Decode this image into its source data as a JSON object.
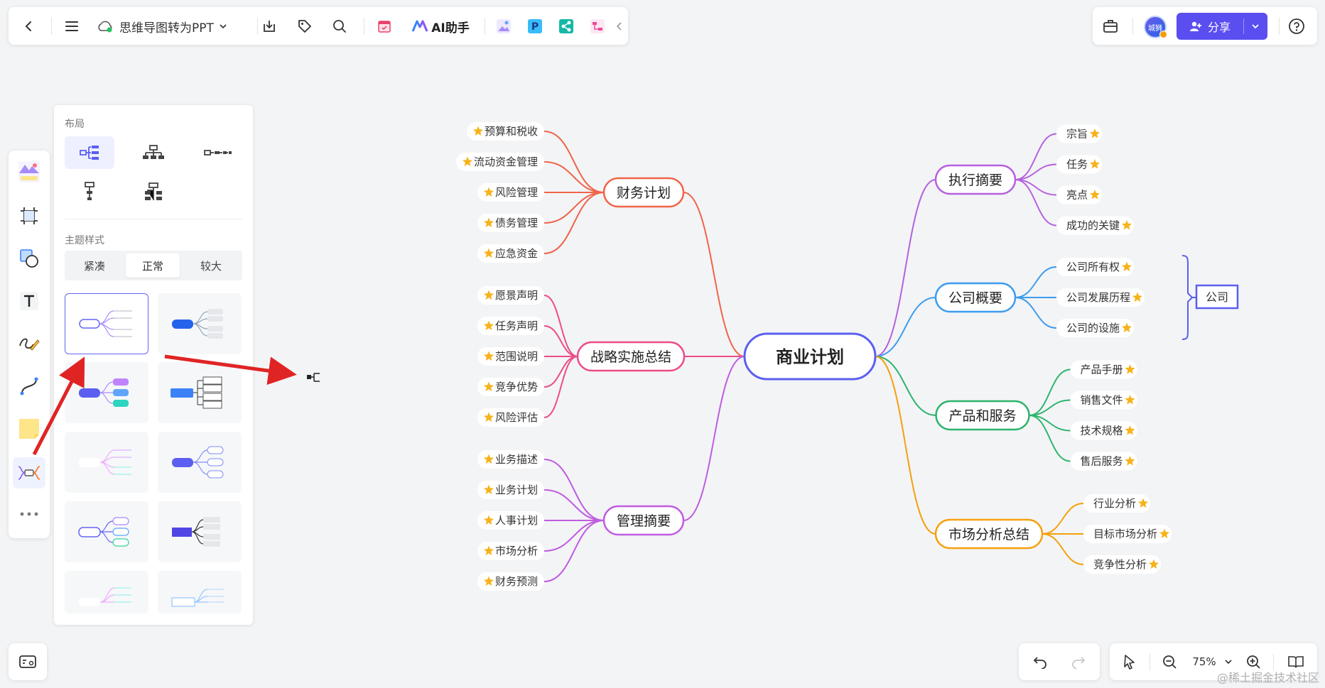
{
  "toolbar": {
    "doc_title": "思维导图转为PPT",
    "ai_label": "AI助手",
    "icons": [
      "back-icon",
      "menu-icon",
      "cloud-icon",
      "chevron-down-icon",
      "download-icon",
      "tag-icon",
      "search-icon",
      "calendar-icon",
      "ai-logo-icon",
      "image-plugin-icon",
      "p-plugin-icon",
      "share-plugin-icon",
      "diagram-plugin-icon",
      "collapse-left-icon"
    ]
  },
  "topright": {
    "avatar_text": "城狮",
    "share_label": "分享"
  },
  "left_toolbar": {
    "icons": [
      "template-icon",
      "frame-icon",
      "shape-icon",
      "text-icon",
      "pen-icon",
      "connector-icon",
      "sticky-note-icon",
      "mindmap-icon",
      "more-icon"
    ]
  },
  "layout_panel": {
    "layout_title": "布局",
    "theme_title": "主题样式",
    "density_options": [
      "紧凑",
      "正常",
      "较大"
    ],
    "density_selected": "正常"
  },
  "mindmap": {
    "root": "商业计划",
    "left_branches": [
      {
        "label": "财务计划",
        "color": "#f06449",
        "children": [
          "预算和税收",
          "流动资金管理",
          "风险管理",
          "债务管理",
          "应急资金"
        ]
      },
      {
        "label": "战略实施总结",
        "color": "#ec4c88",
        "children": [
          "愿景声明",
          "任务声明",
          "范围说明",
          "竞争优势",
          "风险评估"
        ]
      },
      {
        "label": "管理摘要",
        "color": "#c05ce0",
        "children": [
          "业务描述",
          "业务计划",
          "人事计划",
          "市场分析",
          "财务预测"
        ]
      }
    ],
    "right_branches": [
      {
        "label": "执行摘要",
        "color": "#b560e0",
        "children": [
          "宗旨",
          "任务",
          "亮点",
          "成功的关键"
        ]
      },
      {
        "label": "公司概要",
        "color": "#3c9cee",
        "children": [
          "公司所有权",
          "公司发展历程",
          "公司的设施"
        ]
      },
      {
        "label": "产品和服务",
        "color": "#2db36b",
        "children": [
          "产品手册",
          "销售文件",
          "技术规格",
          "售后服务"
        ]
      },
      {
        "label": "市场分析总结",
        "color": "#f5a00c",
        "children": [
          "行业分析",
          "目标市场分析",
          "竞争性分析"
        ]
      }
    ],
    "summary_label": "公司",
    "accent_color": "#5b5ff0"
  },
  "bottom_bar": {
    "zoom": "75%"
  },
  "watermark": "@稀土掘金技术社区"
}
